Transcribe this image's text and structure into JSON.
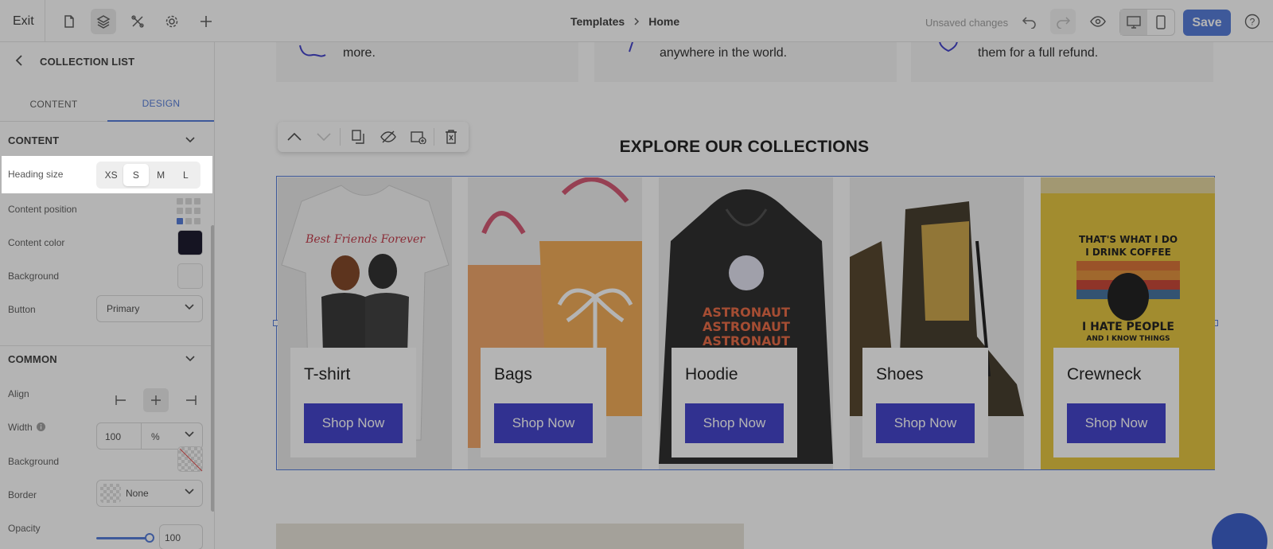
{
  "topbar": {
    "exit_label": "Exit",
    "breadcrumb": [
      "Templates",
      "Home"
    ],
    "unsaved_label": "Unsaved changes",
    "save_label": "Save"
  },
  "sidebar": {
    "title": "COLLECTION LIST",
    "tabs": [
      {
        "label": "CONTENT",
        "active": false
      },
      {
        "label": "DESIGN",
        "active": true
      }
    ],
    "content_section": {
      "title": "CONTENT",
      "heading_size": {
        "label": "Heading size",
        "options": [
          "XS",
          "S",
          "M",
          "L"
        ],
        "selected": "S"
      },
      "content_position_label": "Content position",
      "content_color_label": "Content color",
      "content_color": "#0b0a1f",
      "background_label": "Background",
      "button_label": "Button",
      "button_value": "Primary"
    },
    "common_section": {
      "title": "COMMON",
      "align_label": "Align",
      "width_label": "Width",
      "width_value": "100",
      "width_unit": "%",
      "background_label": "Background",
      "border_label": "Border",
      "border_value": "None",
      "opacity_label": "Opacity",
      "opacity_value": "100"
    }
  },
  "canvas": {
    "features": [
      "more.",
      "anywhere in the world.",
      "them for a full refund."
    ],
    "collections_title": "EXPLORE OUR COLLECTIONS",
    "collections": [
      {
        "name": "T-shirt",
        "button": "Shop Now"
      },
      {
        "name": "Bags",
        "button": "Shop Now"
      },
      {
        "name": "Hoodie",
        "button": "Shop Now"
      },
      {
        "name": "Shoes",
        "button": "Shop Now"
      },
      {
        "name": "Crewneck",
        "button": "Shop Now"
      }
    ]
  },
  "colors": {
    "accent": "#4a74d8",
    "shop_button": "#3737c8"
  }
}
